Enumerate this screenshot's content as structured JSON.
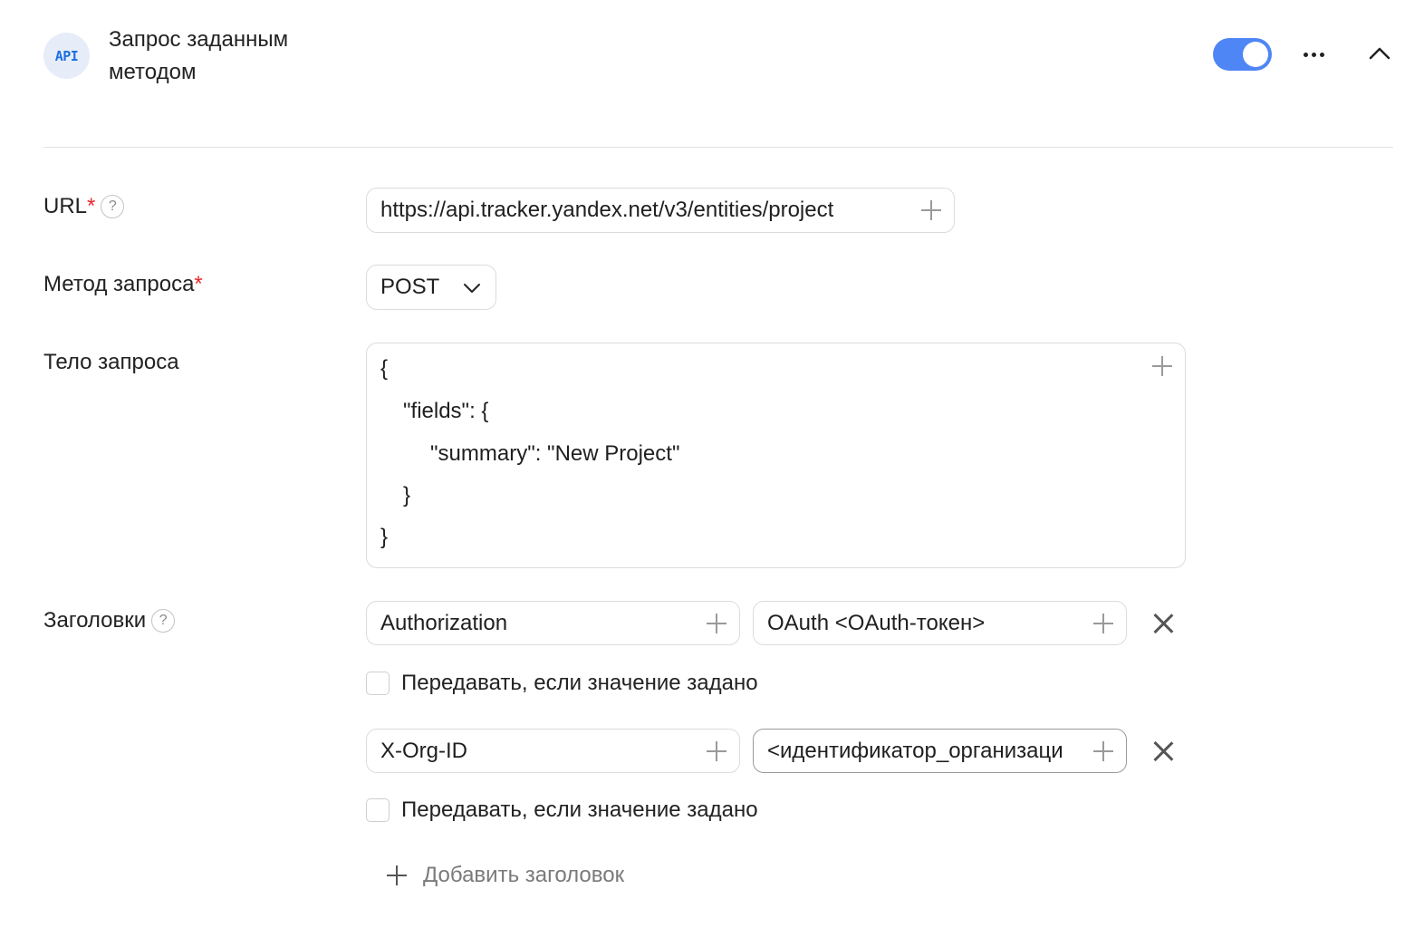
{
  "header": {
    "badge": "API",
    "title_line1": "Запрос заданным",
    "title_line2": "методом",
    "toggle_on": true
  },
  "form": {
    "url": {
      "label": "URL",
      "required_mark": "*",
      "help": "?",
      "value": "https://api.tracker.yandex.net/v3/entities/project"
    },
    "method": {
      "label": "Метод запроса",
      "required_mark": "*",
      "value": "POST"
    },
    "body": {
      "label": "Тело запроса",
      "lines": [
        "{",
        "\"fields\": {",
        "\"summary\": \"New Project\"",
        "}",
        "}"
      ]
    },
    "headers": {
      "label": "Заголовки",
      "help": "?",
      "items": [
        {
          "name": "Authorization",
          "value": "OAuth <OAuth-токен>",
          "checkbox_label": "Передавать, если значение задано",
          "checked": false
        },
        {
          "name": "X-Org-ID",
          "value": "<идентификатор_организаци",
          "checkbox_label": "Передавать, если значение задано",
          "checked": false
        }
      ],
      "add_label": "Добавить заголовок"
    }
  },
  "colors": {
    "accent": "#4f86f5",
    "required": "#e8282f",
    "badge_bg": "#e6edf8",
    "badge_text": "#1c6fe0"
  }
}
